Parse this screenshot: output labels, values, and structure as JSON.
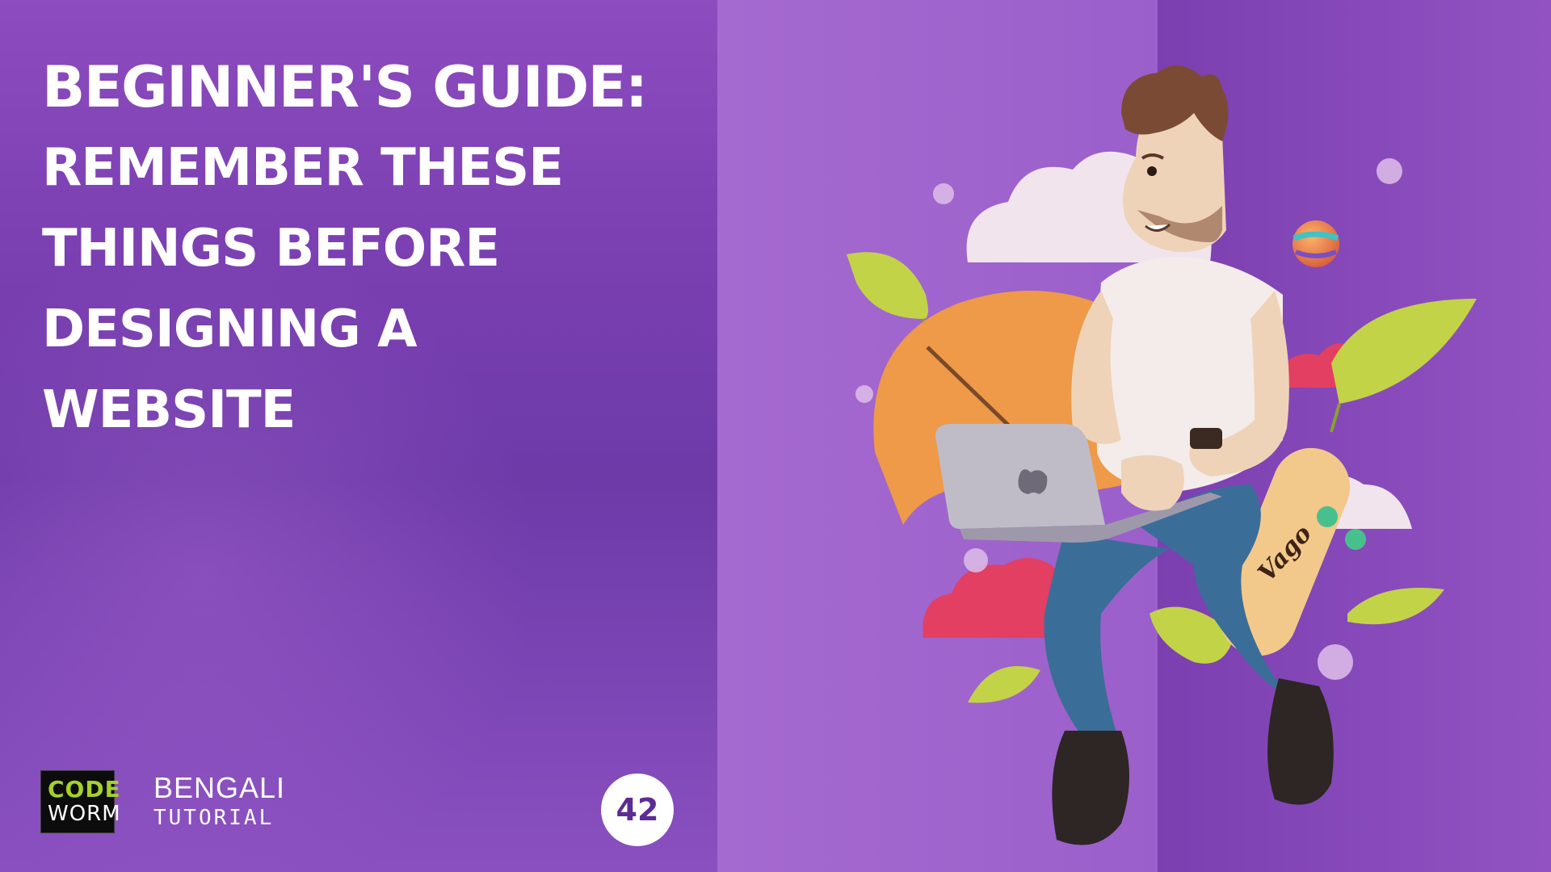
{
  "title": {
    "line1": "BEGINNER'S GUIDE:",
    "line2": "REMEMBER THESE",
    "line3": "THINGS BEFORE",
    "line4": "DESIGNING A",
    "line5": "WEBSITE"
  },
  "logo": {
    "code": "CODE",
    "worm": "WORM"
  },
  "badge": {
    "title": "BENGALI",
    "subtitle": "TUTORIAL"
  },
  "episode": "42",
  "illustration": {
    "skateboard_text": "Vago"
  },
  "colors": {
    "bg_purple": "#7a3fb1",
    "logo_green": "#a6d02a",
    "episode_text": "#5d2c93"
  }
}
